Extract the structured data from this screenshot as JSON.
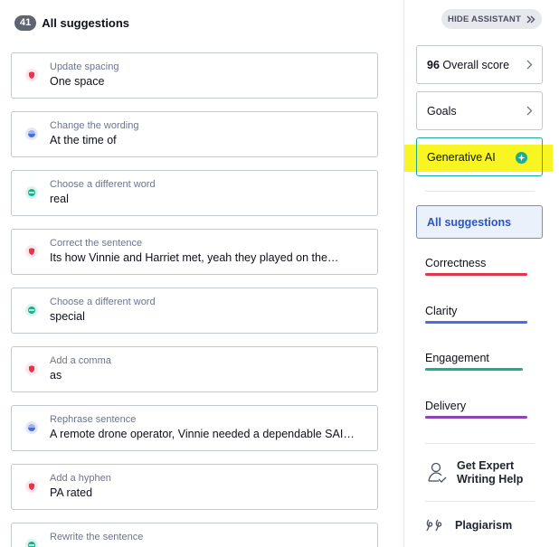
{
  "header": {
    "count": "41",
    "title": "All suggestions"
  },
  "suggestions": [
    {
      "category": "Update spacing",
      "text": "One space",
      "type": "correctness"
    },
    {
      "category": "Change the wording",
      "text": "At the time of",
      "type": "clarity"
    },
    {
      "category": "Choose a different word",
      "text": "real",
      "type": "engagement"
    },
    {
      "category": "Correct the sentence",
      "text": "Its how Vinnie and Harriet met, yeah they played on the…",
      "type": "correctness"
    },
    {
      "category": "Choose a different word",
      "text": "special",
      "type": "engagement"
    },
    {
      "category": "Add a comma",
      "text": "as",
      "type": "correctness"
    },
    {
      "category": "Rephrase sentence",
      "text": "A remote drone operator, Vinnie needed a dependable SAI …",
      "type": "clarity"
    },
    {
      "category": "Add a hyphen",
      "text": "PA rated",
      "type": "correctness"
    },
    {
      "category": "Rewrite the sentence",
      "text": "",
      "type": "engagement"
    }
  ],
  "assistant": {
    "hide_label": "HIDE ASSISTANT",
    "score_value": "96",
    "score_label": "Overall score",
    "goals_label": "Goals",
    "genai_label": "Generative AI",
    "all_suggestions_label": "All suggestions",
    "categories": [
      {
        "label": "Correctness",
        "color": "#e2364a"
      },
      {
        "label": "Clarity",
        "color": "#4a6ee0"
      },
      {
        "label": "Engagement",
        "color": "#16b08f"
      },
      {
        "label": "Delivery",
        "color": "#8e44b8"
      }
    ],
    "expert_label": "Get Expert Writing Help",
    "expert_line1": "Get Expert",
    "expert_line2": "Writing Help",
    "plagiarism_label": "Plagiarism"
  },
  "colors": {
    "correctness": "#e2364a",
    "clarity": "#4a6ee0",
    "engagement": "#16b08f",
    "highlight": "#f8f522",
    "genai_border": "#18a99c"
  },
  "icons": {
    "correctness": "red-shield-icon",
    "clarity": "blue-half-circle-icon",
    "engagement": "green-circle-icon",
    "hide": "double-chevron-right-icon",
    "chevron": "chevron-right-icon",
    "genai": "green-sparkle-icon",
    "expert": "person-icon",
    "plagiarism": "quote-icon"
  }
}
